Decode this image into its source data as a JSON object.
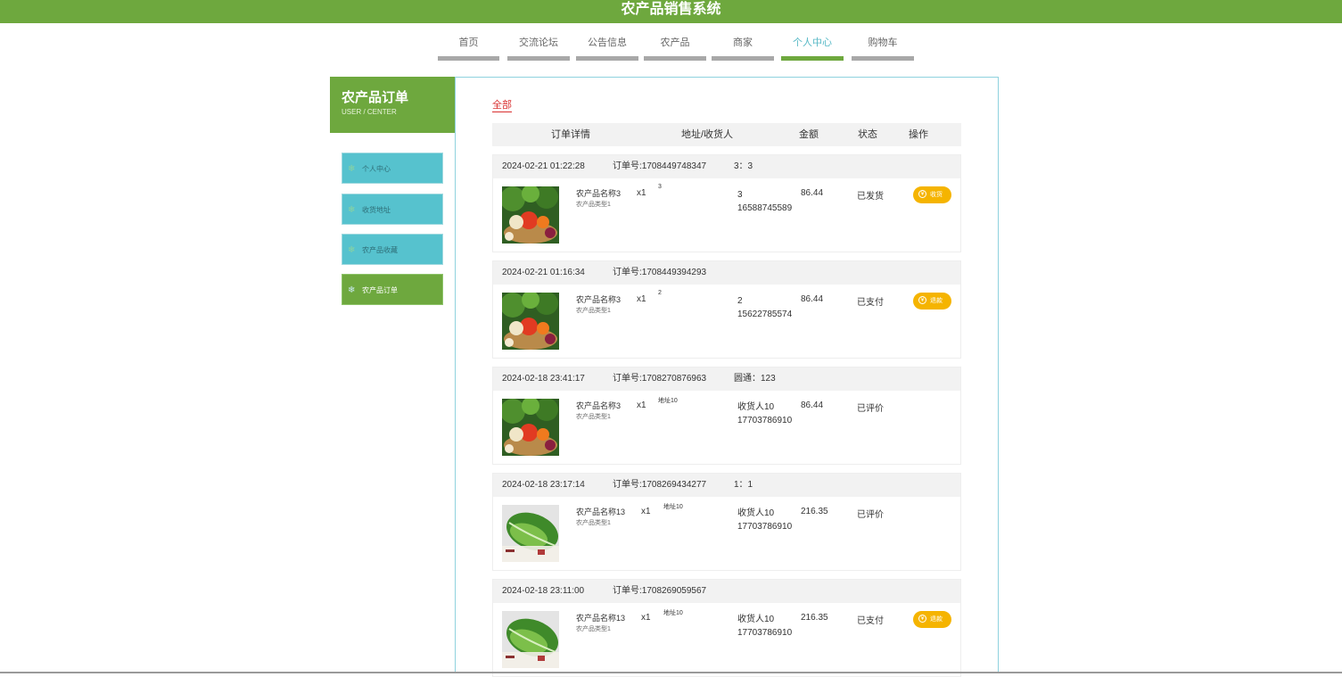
{
  "app": {
    "title": "农产品销售系统"
  },
  "nav": {
    "items": [
      {
        "label": "首页"
      },
      {
        "label": "交流论坛"
      },
      {
        "label": "公告信息"
      },
      {
        "label": "农产品"
      },
      {
        "label": "商家"
      },
      {
        "label": "个人中心",
        "active": true
      },
      {
        "label": "购物车"
      }
    ]
  },
  "sidebar": {
    "title": "农产品订单",
    "subtitle": "USER / CENTER",
    "items": [
      {
        "label": "个人中心",
        "icon": "snowflake-icon"
      },
      {
        "label": "收货地址",
        "icon": "snowflake-icon"
      },
      {
        "label": "农产品收藏",
        "icon": "snowflake-icon"
      },
      {
        "label": "农产品订单",
        "icon": "snowflake-icon",
        "active": true
      }
    ]
  },
  "filter": {
    "all_label": "全部"
  },
  "table": {
    "headers": [
      "订单详情",
      "地址/收货人",
      "金额",
      "状态",
      "操作"
    ]
  },
  "orders": [
    {
      "time": "2024-02-21 01:22:28",
      "order_no": "订单号:1708449748347",
      "extra": "3：3",
      "product": "农产品名称3",
      "type": "农产品类型1",
      "qty": "x1",
      "address": "3",
      "receiver": "3",
      "phone": "16588745589",
      "amount": "86.44",
      "status": "已发货",
      "action": "收货",
      "image": "vegetable-basket"
    },
    {
      "time": "2024-02-21 01:16:34",
      "order_no": "订单号:1708449394293",
      "extra": "",
      "product": "农产品名称3",
      "type": "农产品类型1",
      "qty": "x1",
      "address": "2",
      "receiver": "2",
      "phone": "15622785574",
      "amount": "86.44",
      "status": "已支付",
      "action": "退款",
      "image": "vegetable-basket"
    },
    {
      "time": "2024-02-18 23:41:17",
      "order_no": "订单号:1708270876963",
      "extra": "圆通：123",
      "product": "农产品名称3",
      "type": "农产品类型1",
      "qty": "x1",
      "address": "地址10",
      "receiver": "收货人10",
      "phone": "17703786910",
      "amount": "86.44",
      "status": "已评价",
      "action": "",
      "image": "vegetable-basket"
    },
    {
      "time": "2024-02-18 23:17:14",
      "order_no": "订单号:1708269434277",
      "extra": "1：1",
      "product": "农产品名称13",
      "type": "农产品类型1",
      "qty": "x1",
      "address": "地址10",
      "receiver": "收货人10",
      "phone": "17703786910",
      "amount": "216.35",
      "status": "已评价",
      "action": "",
      "image": "cabbage"
    },
    {
      "time": "2024-02-18 23:11:00",
      "order_no": "订单号:1708269059567",
      "extra": "",
      "product": "农产品名称13",
      "type": "农产品类型1",
      "qty": "x1",
      "address": "地址10",
      "receiver": "收货人10",
      "phone": "17703786910",
      "amount": "216.35",
      "status": "已支付",
      "action": "退款",
      "image": "cabbage"
    }
  ],
  "colors": {
    "brand_green": "#6ea83e",
    "sidebar_teal": "#56c2ce",
    "action_yellow": "#f5b400",
    "link_red": "#d93030"
  }
}
